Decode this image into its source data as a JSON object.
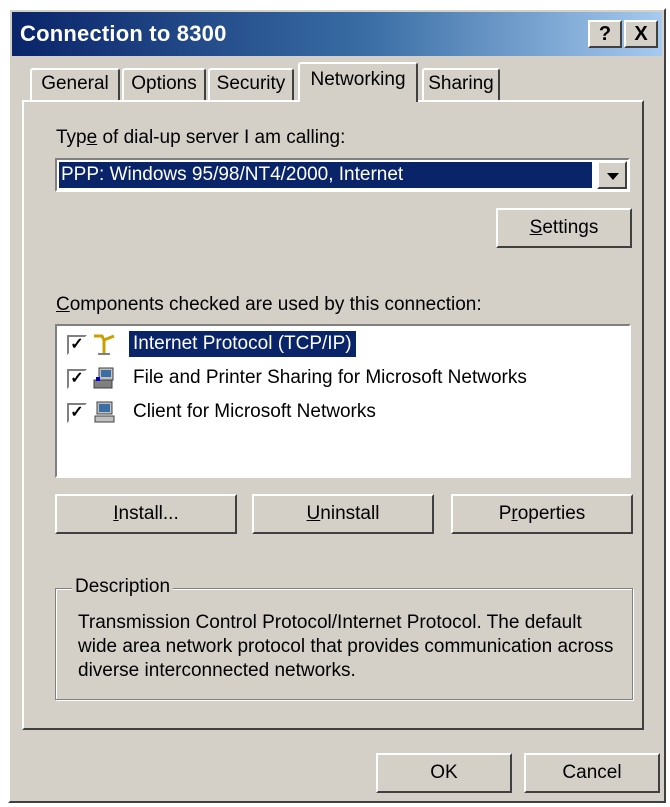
{
  "window": {
    "title": "Connection to 8300",
    "help_glyph": "?",
    "close_glyph": "X"
  },
  "tabs": [
    {
      "label": "General",
      "active": false
    },
    {
      "label": "Options",
      "active": false
    },
    {
      "label": "Security",
      "active": false
    },
    {
      "label": "Networking",
      "active": true
    },
    {
      "label": "Sharing",
      "active": false
    }
  ],
  "server": {
    "label_pre": "Typ",
    "label_u": "e",
    "label_post": " of dial-up server I am calling:",
    "value": "PPP: Windows 95/98/NT4/2000, Internet",
    "settings_u": "S",
    "settings_rest": "ettings"
  },
  "components": {
    "label_u": "C",
    "label_rest": "omponents checked are used by this connection:",
    "items": [
      {
        "label": "Internet Protocol (TCP/IP)",
        "checked": true,
        "selected": true,
        "icon": "network-protocol-icon"
      },
      {
        "label": "File and Printer Sharing for Microsoft Networks",
        "checked": true,
        "selected": false,
        "icon": "file-printer-sharing-icon"
      },
      {
        "label": "Client for Microsoft Networks",
        "checked": true,
        "selected": false,
        "icon": "network-client-icon"
      }
    ],
    "check_glyph": "✓"
  },
  "buttons": {
    "install_u": "I",
    "install_rest": "nstall...",
    "uninstall_u": "U",
    "uninstall_rest": "ninstall",
    "properties_pre": "P",
    "properties_u": "r",
    "properties_rest": "operties"
  },
  "description": {
    "title": "Description",
    "text": "Transmission Control Protocol/Internet Protocol. The default wide area network protocol that provides communication across diverse interconnected networks."
  },
  "footer": {
    "ok_label": "OK",
    "cancel_label": "Cancel"
  },
  "colors": {
    "face": "#d4d0c8",
    "selection": "#0a246a",
    "title_gradient_start": "#0a246a",
    "title_gradient_end": "#a6caf0"
  }
}
